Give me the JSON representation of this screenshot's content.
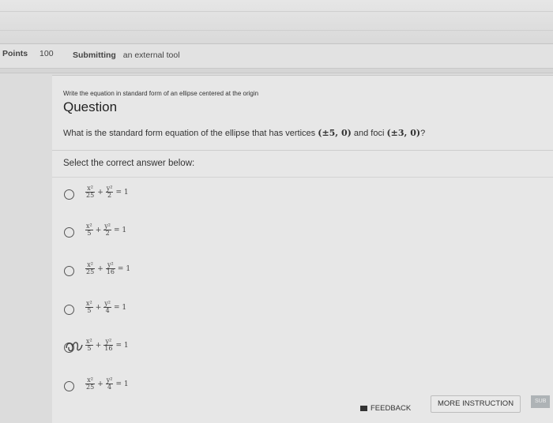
{
  "meta": {
    "points_label": "Points",
    "points_value": "100",
    "submitting_label": "Submitting",
    "submitting_value": "an external tool"
  },
  "question": {
    "instruction": "Write the equation in standard form of an ellipse centered at the origin",
    "title": "Question",
    "prompt_prefix": "What is the standard form equation of the ellipse that has vertices ",
    "vertices": "(±5, 0)",
    "prompt_mid": " and foci ",
    "foci": "(±3, 0)",
    "prompt_suffix": "?",
    "select_label": "Select the correct answer below:"
  },
  "options": [
    {
      "a": "25",
      "b": "2"
    },
    {
      "a": "5",
      "b": "2"
    },
    {
      "a": "25",
      "b": "16"
    },
    {
      "a": "5",
      "b": "4"
    },
    {
      "a": "5",
      "b": "16"
    },
    {
      "a": "25",
      "b": "4"
    }
  ],
  "formula": {
    "x": "x²",
    "y": "y²",
    "plus": "+",
    "eq": "= 1"
  },
  "footer": {
    "feedback": "FEEDBACK",
    "more_instruction": "MORE INSTRUCTION",
    "submit": "SUB"
  }
}
